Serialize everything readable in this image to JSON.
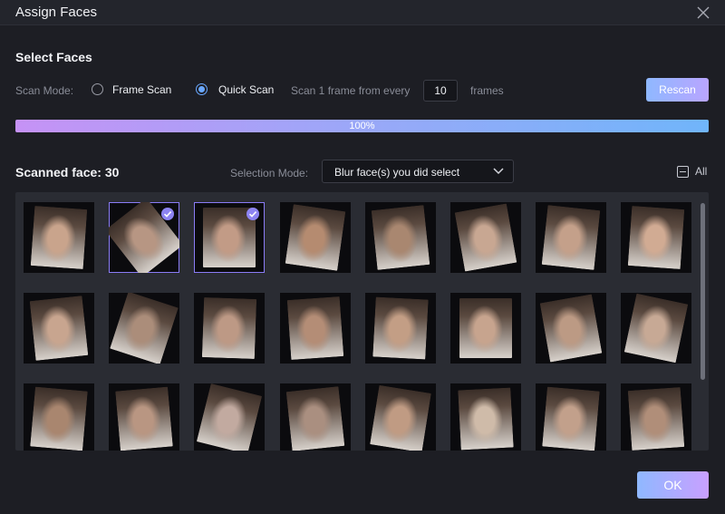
{
  "window": {
    "title": "Assign Faces",
    "close_icon": "close-icon"
  },
  "select_faces": {
    "heading": "Select Faces",
    "scan_mode_label": "Scan Mode:",
    "modes": [
      {
        "label": "Frame Scan",
        "checked": false
      },
      {
        "label": "Quick Scan",
        "checked": true
      }
    ],
    "every_label": "Scan 1 frame from every",
    "frames_value": "10",
    "frames_label": "frames",
    "rescan_label": "Rescan",
    "progress_text": "100%",
    "progress_value": 1.0
  },
  "scanned": {
    "count_label": "Scanned face: 30",
    "selection_mode_label": "Selection Mode:",
    "selection_mode_value": "Blur face(s) you did select",
    "all_label": "All"
  },
  "faces": [
    {
      "selected": false,
      "tone": "#c9a48c",
      "rotate": 4
    },
    {
      "selected": true,
      "tone": "#b79683",
      "rotate": -38
    },
    {
      "selected": true,
      "tone": "#c29b86",
      "rotate": 0
    },
    {
      "selected": false,
      "tone": "#b58b70",
      "rotate": 8
    },
    {
      "selected": false,
      "tone": "#a98770",
      "rotate": -6
    },
    {
      "selected": false,
      "tone": "#c8a792",
      "rotate": -10
    },
    {
      "selected": false,
      "tone": "#c4a08a",
      "rotate": 6
    },
    {
      "selected": false,
      "tone": "#d1ab93",
      "rotate": 4
    },
    {
      "selected": false,
      "tone": "#c8a58f",
      "rotate": -6
    },
    {
      "selected": false,
      "tone": "#ab8d7a",
      "rotate": 18
    },
    {
      "selected": false,
      "tone": "#bd9985",
      "rotate": 2
    },
    {
      "selected": false,
      "tone": "#b48d76",
      "rotate": -4
    },
    {
      "selected": false,
      "tone": "#c39e85",
      "rotate": 3
    },
    {
      "selected": false,
      "tone": "#c7a48e",
      "rotate": 0
    },
    {
      "selected": false,
      "tone": "#bc9a84",
      "rotate": -10
    },
    {
      "selected": false,
      "tone": "#c7a995",
      "rotate": 12
    },
    {
      "selected": false,
      "tone": "#a9866f",
      "rotate": 5
    },
    {
      "selected": false,
      "tone": "#b99682",
      "rotate": -5
    },
    {
      "selected": false,
      "tone": "#c2aaa0",
      "rotate": 14
    },
    {
      "selected": false,
      "tone": "#aa8f80",
      "rotate": -6
    },
    {
      "selected": false,
      "tone": "#c09b83",
      "rotate": 9
    },
    {
      "selected": false,
      "tone": "#cfbba9",
      "rotate": -3
    },
    {
      "selected": false,
      "tone": "#c2a08b",
      "rotate": 5
    },
    {
      "selected": false,
      "tone": "#b08e79",
      "rotate": -4
    }
  ],
  "footer": {
    "ok_label": "OK"
  },
  "colors": {
    "accent": "#8d84f2",
    "radio_checked": "#6aa8ff"
  }
}
